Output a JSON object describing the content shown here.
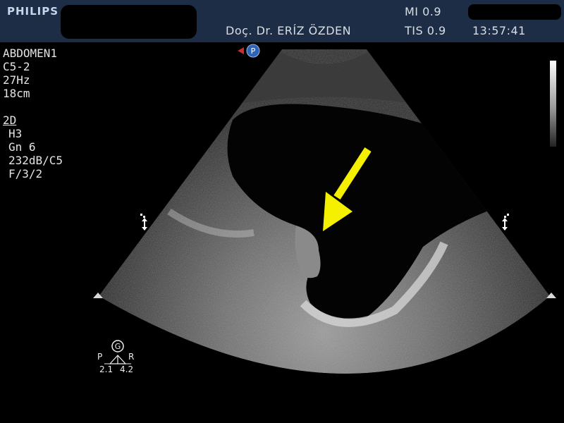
{
  "header": {
    "brand": "PHILIPS",
    "physician": "Doç. Dr. ERÍZ ÖZDEN",
    "mi": "MI 0.9",
    "tis": "TIS 0.9",
    "time": "13:57:41"
  },
  "params": {
    "preset": "ABDOMEN1",
    "probe": "C5-2",
    "frame_rate": "27Hz",
    "depth": "18cm",
    "mode": "2D",
    "harmonic": "H3",
    "gain": "Gn 6",
    "dynamic_range": "232dB/C5",
    "filter": "F/3/2"
  },
  "markers": {
    "probe_marker": "P",
    "orientation_badge": "G",
    "left_label": "P",
    "right_label": "R",
    "left_value": "2.1",
    "right_value": "4.2"
  },
  "colors": {
    "header_bg": "#1d2d46",
    "arrow": "#f5f000",
    "probe_marker_bg": "#2f63b8",
    "probe_marker_arrow": "#c83030"
  },
  "icons": {
    "focus_left": "focus-zone-icon",
    "focus_right": "focus-zone-icon",
    "edge_left": "triangle-icon",
    "edge_right": "triangle-icon"
  }
}
